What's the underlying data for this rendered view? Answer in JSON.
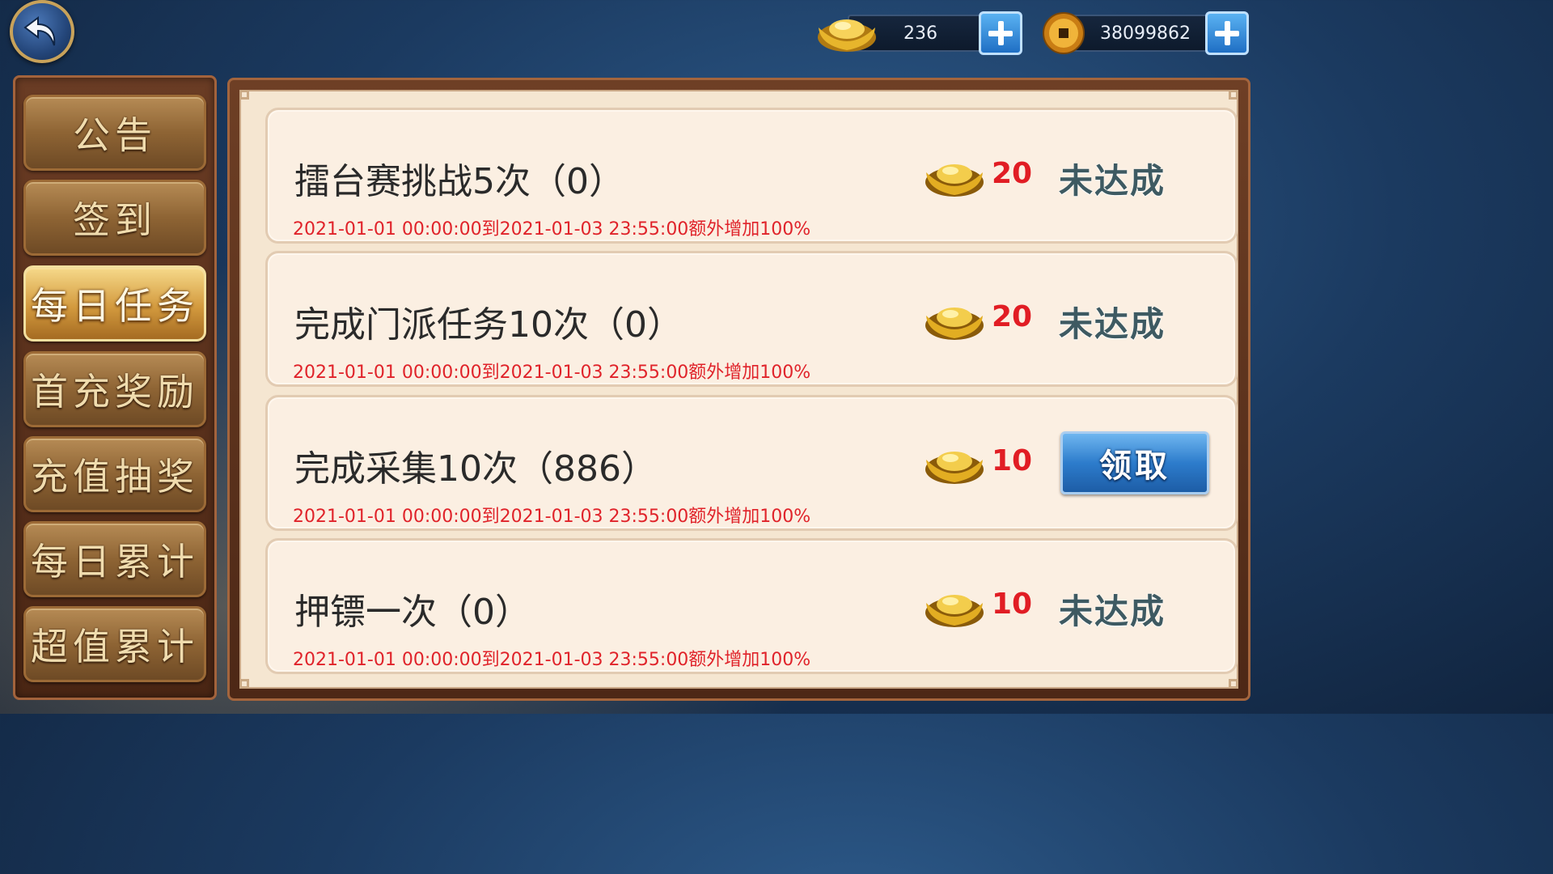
{
  "topbar": {
    "back_icon": "back-arrow-icon",
    "ingot_count": "236",
    "coin_count": "38099862",
    "ingot_icon": "gold-ingot-icon",
    "coin_icon": "copper-coin-icon",
    "plus_icon": "plus-icon"
  },
  "sidebar": {
    "items": [
      {
        "label": "公告",
        "active": false
      },
      {
        "label": "签到",
        "active": false
      },
      {
        "label": "每日任务",
        "active": true
      },
      {
        "label": "首充奖励",
        "active": false
      },
      {
        "label": "充值抽奖",
        "active": false
      },
      {
        "label": "每日累计",
        "active": false
      },
      {
        "label": "超值累计",
        "active": false
      }
    ]
  },
  "tasks": [
    {
      "title": "擂台赛挑战5次（0）",
      "time": "2021-01-01 00:00:00到2021-01-03 23:55:00额外增加100%",
      "reward": "20",
      "status": "未达成"
    },
    {
      "title": "完成门派任务10次（0）",
      "time": "2021-01-01 00:00:00到2021-01-03 23:55:00额外增加100%",
      "reward": "20",
      "status": "未达成"
    },
    {
      "title": "完成采集10次（886）",
      "time": "2021-01-01 00:00:00到2021-01-03 23:55:00额外增加100%",
      "reward": "10",
      "button": "领取"
    },
    {
      "title": "押镖一次（0）",
      "time": "2021-01-01 00:00:00到2021-01-03 23:55:00额外增加100%",
      "reward": "10",
      "status": "未达成"
    }
  ],
  "colors": {
    "reward_text": "#e11d24",
    "time_text": "#e0232a",
    "status_text": "#3e5a62",
    "accent_blue": "#2d7ccc"
  }
}
